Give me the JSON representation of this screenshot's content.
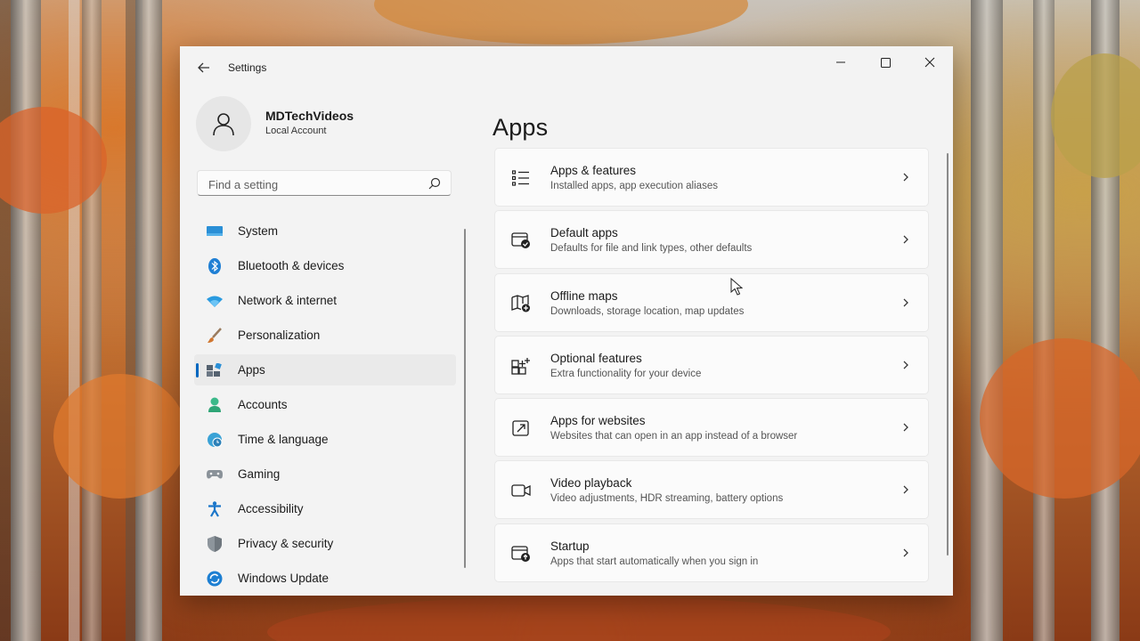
{
  "window": {
    "app_title": "Settings"
  },
  "profile": {
    "name": "MDTechVideos",
    "account_type": "Local Account"
  },
  "search": {
    "placeholder": "Find a setting"
  },
  "sidebar": {
    "items": [
      {
        "label": "System",
        "icon": "system-icon",
        "active": false
      },
      {
        "label": "Bluetooth & devices",
        "icon": "bluetooth-icon",
        "active": false
      },
      {
        "label": "Network & internet",
        "icon": "wifi-icon",
        "active": false
      },
      {
        "label": "Personalization",
        "icon": "brush-icon",
        "active": false
      },
      {
        "label": "Apps",
        "icon": "apps-icon",
        "active": true
      },
      {
        "label": "Accounts",
        "icon": "accounts-icon",
        "active": false
      },
      {
        "label": "Time & language",
        "icon": "globe-clock-icon",
        "active": false
      },
      {
        "label": "Gaming",
        "icon": "gamepad-icon",
        "active": false
      },
      {
        "label": "Accessibility",
        "icon": "accessibility-icon",
        "active": false
      },
      {
        "label": "Privacy & security",
        "icon": "shield-icon",
        "active": false
      },
      {
        "label": "Windows Update",
        "icon": "update-icon",
        "active": false
      }
    ]
  },
  "main": {
    "title": "Apps",
    "cards": [
      {
        "title": "Apps & features",
        "subtitle": "Installed apps, app execution aliases",
        "icon": "list-icon"
      },
      {
        "title": "Default apps",
        "subtitle": "Defaults for file and link types, other defaults",
        "icon": "default-apps-icon"
      },
      {
        "title": "Offline maps",
        "subtitle": "Downloads, storage location, map updates",
        "icon": "map-icon"
      },
      {
        "title": "Optional features",
        "subtitle": "Extra functionality for your device",
        "icon": "optional-features-icon"
      },
      {
        "title": "Apps for websites",
        "subtitle": "Websites that can open in an app instead of a browser",
        "icon": "open-external-icon"
      },
      {
        "title": "Video playback",
        "subtitle": "Video adjustments, HDR streaming, battery options",
        "icon": "video-icon"
      },
      {
        "title": "Startup",
        "subtitle": "Apps that start automatically when you sign in",
        "icon": "startup-icon"
      }
    ]
  },
  "colors": {
    "accent": "#0067c0",
    "window_bg": "#f3f3f3",
    "card_bg": "#fbfbfb"
  }
}
